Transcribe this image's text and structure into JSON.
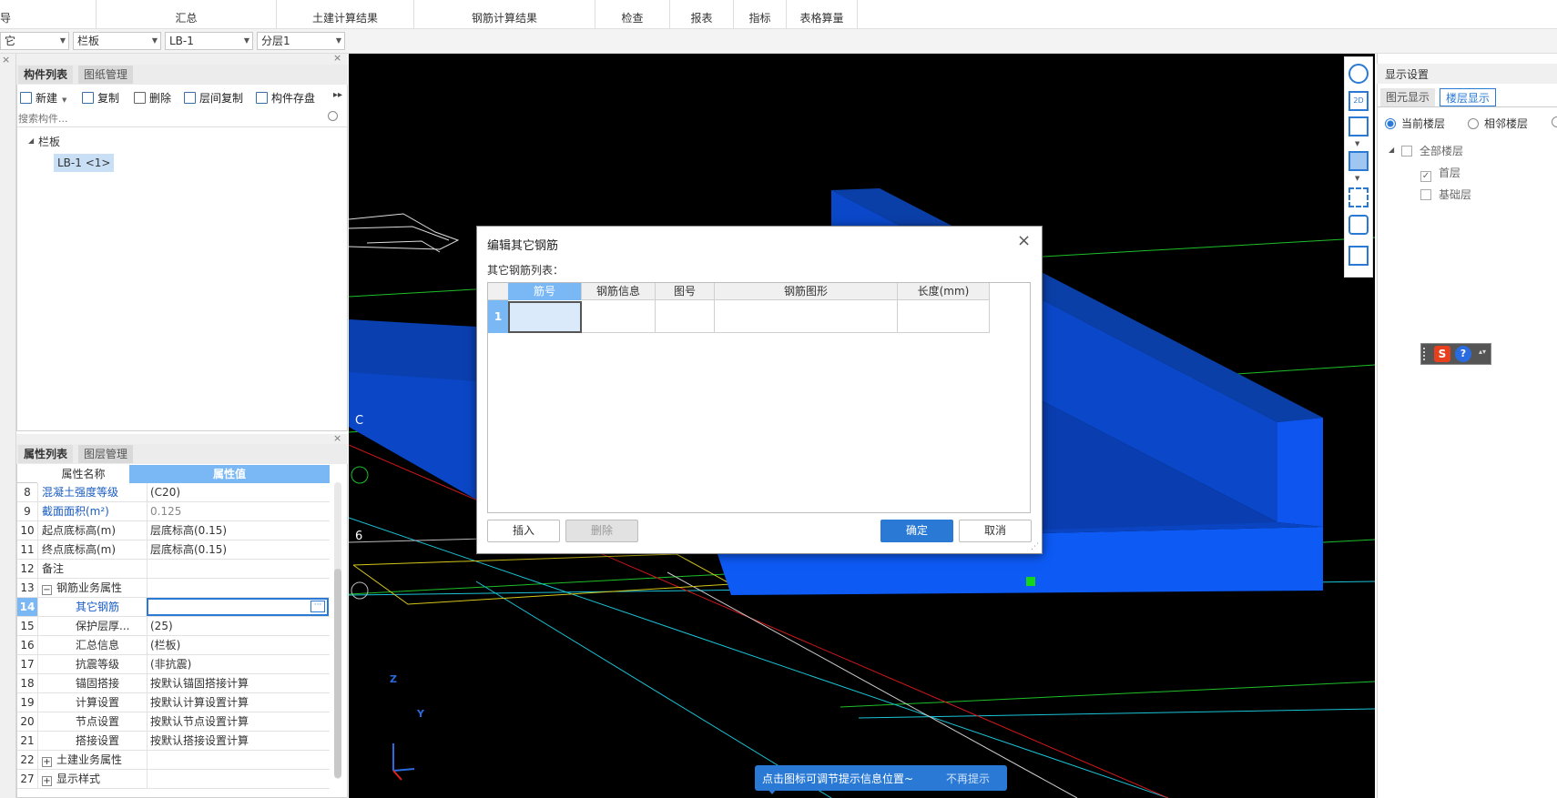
{
  "ribbon": {
    "tabs": [
      "导",
      "汇总",
      "土建计算结果",
      "钢筋计算结果",
      "检查",
      "报表",
      "指标",
      "表格算量"
    ]
  },
  "combos": [
    {
      "value": "它"
    },
    {
      "value": "栏板"
    },
    {
      "value": "LB-1"
    },
    {
      "value": "分层1"
    }
  ],
  "component_panel": {
    "tab_active": "构件列表",
    "tab_inactive": "图纸管理",
    "toolbar": {
      "new": "新建",
      "copy": "复制",
      "delete": "删除",
      "floor_copy": "层间复制",
      "save": "构件存盘"
    },
    "search_placeholder": "搜索构件...",
    "tree_root": "栏板",
    "tree_item": "LB-1 <1>"
  },
  "property_panel": {
    "tab_active": "属性列表",
    "tab_inactive": "图层管理",
    "header_name": "属性名称",
    "header_value": "属性值",
    "rows": [
      {
        "num": "8",
        "name": "混凝土强度等级",
        "value": "(C20)"
      },
      {
        "num": "9",
        "name": "截面面积(m²)",
        "value": "0.125"
      },
      {
        "num": "10",
        "name": "起点底标高(m)",
        "value": "层底标高(0.15)"
      },
      {
        "num": "11",
        "name": "终点底标高(m)",
        "value": "层底标高(0.15)"
      },
      {
        "num": "12",
        "name": "备注",
        "value": ""
      },
      {
        "num": "13",
        "name": "钢筋业务属性",
        "value": ""
      },
      {
        "num": "14",
        "name": "其它钢筋",
        "value": ""
      },
      {
        "num": "15",
        "name": "保护层厚...",
        "value": "(25)"
      },
      {
        "num": "16",
        "name": "汇总信息",
        "value": "(栏板)"
      },
      {
        "num": "17",
        "name": "抗震等级",
        "value": "(非抗震)"
      },
      {
        "num": "18",
        "name": "锚固搭接",
        "value": "按默认锚固搭接计算"
      },
      {
        "num": "19",
        "name": "计算设置",
        "value": "按默认计算设置计算"
      },
      {
        "num": "20",
        "name": "节点设置",
        "value": "按默认节点设置计算"
      },
      {
        "num": "21",
        "name": "搭接设置",
        "value": "按默认搭接设置计算"
      },
      {
        "num": "22",
        "name": "土建业务属性",
        "value": ""
      },
      {
        "num": "27",
        "name": "显示样式",
        "value": ""
      }
    ]
  },
  "viewport": {
    "axis_c": "C",
    "axis_6": "6",
    "axis_z": "Z",
    "axis_y": "Y",
    "hint_text": "点击图标可调节提示信息位置~",
    "hint_dismiss": "不再提示"
  },
  "dialog": {
    "title": "编辑其它钢筋",
    "list_label": "其它钢筋列表：",
    "columns": [
      "筋号",
      "钢筋信息",
      "图号",
      "钢筋图形",
      "长度(mm)"
    ],
    "row_num": "1",
    "insert": "插入",
    "delete": "删除",
    "ok": "确定",
    "cancel": "取消"
  },
  "display_settings": {
    "title": "显示设置",
    "tab_inactive": "图元显示",
    "tab_active": "楼层显示",
    "radio_current": "当前楼层",
    "radio_adjacent": "相邻楼层",
    "all_floors": "全部楼层",
    "floor_1": "首层",
    "floor_base": "基础层"
  },
  "colors": {
    "accent": "#2a7ad5",
    "header_blue": "#7ab8f5",
    "viewport_bg": "#000000",
    "slab_blue": "#0a4fd8"
  }
}
